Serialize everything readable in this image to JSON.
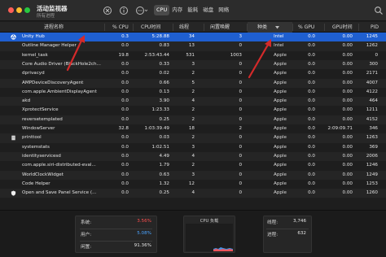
{
  "window": {
    "title": "活动监视器",
    "subtitle": "所有进程"
  },
  "toolbar": {
    "tabs": [
      "CPU",
      "内存",
      "能耗",
      "磁盘",
      "网络"
    ],
    "active_tab": "CPU",
    "icons": [
      "close-process-icon",
      "info-icon",
      "more-options-icon",
      "search-icon"
    ]
  },
  "table": {
    "columns": [
      "进程名称",
      "% CPU",
      "CPU时间",
      "线程",
      "闲置唤醒",
      "种类",
      "% GPU",
      "GPU时间",
      "PID"
    ],
    "sort_column": "种类",
    "rows": [
      {
        "name": "Unity Hub",
        "cpu": "0.3",
        "cpu_time": "5:28.88",
        "threads": "34",
        "idle_wakeups": "3",
        "kind": "Intel",
        "gpu": "0.0",
        "gpu_time": "0.00",
        "pid": "1245",
        "icon": "unity-icon",
        "selected": true
      },
      {
        "name": "Outline Manager Helper",
        "cpu": "0.0",
        "cpu_time": "0.83",
        "threads": "13",
        "idle_wakeups": "0",
        "kind": "Intel",
        "gpu": "0.0",
        "gpu_time": "0.00",
        "pid": "1262"
      },
      {
        "name": "kernel_task",
        "cpu": "19.8",
        "cpu_time": "2:53:43.44",
        "threads": "531",
        "idle_wakeups": "1003",
        "kind": "Apple",
        "gpu": "0.0",
        "gpu_time": "0.00",
        "pid": "0"
      },
      {
        "name": "Core Audio Driver (BlackHole2ch...",
        "cpu": "0.0",
        "cpu_time": "0.33",
        "threads": "3",
        "idle_wakeups": "0",
        "kind": "Apple",
        "gpu": "0.0",
        "gpu_time": "0.00",
        "pid": "300"
      },
      {
        "name": "dprivacyd",
        "cpu": "0.0",
        "cpu_time": "0.02",
        "threads": "2",
        "idle_wakeups": "0",
        "kind": "Apple",
        "gpu": "0.0",
        "gpu_time": "0.00",
        "pid": "2171"
      },
      {
        "name": "AMPDeviceDiscoveryAgent",
        "cpu": "0.0",
        "cpu_time": "0.66",
        "threads": "5",
        "idle_wakeups": "0",
        "kind": "Apple",
        "gpu": "0.0",
        "gpu_time": "0.00",
        "pid": "4007"
      },
      {
        "name": "com.apple.AmbientDisplayAgent",
        "cpu": "0.0",
        "cpu_time": "0.13",
        "threads": "2",
        "idle_wakeups": "0",
        "kind": "Apple",
        "gpu": "0.0",
        "gpu_time": "0.00",
        "pid": "4122"
      },
      {
        "name": "akd",
        "cpu": "0.0",
        "cpu_time": "3.90",
        "threads": "4",
        "idle_wakeups": "0",
        "kind": "Apple",
        "gpu": "0.0",
        "gpu_time": "0.00",
        "pid": "464"
      },
      {
        "name": "XprotectService",
        "cpu": "0.0",
        "cpu_time": "1:23.33",
        "threads": "2",
        "idle_wakeups": "0",
        "kind": "Apple",
        "gpu": "0.0",
        "gpu_time": "0.00",
        "pid": "1211"
      },
      {
        "name": "reversetemplated",
        "cpu": "0.0",
        "cpu_time": "0.25",
        "threads": "2",
        "idle_wakeups": "0",
        "kind": "Apple",
        "gpu": "0.0",
        "gpu_time": "0.00",
        "pid": "4152"
      },
      {
        "name": "WindowServer",
        "cpu": "32.8",
        "cpu_time": "1:03:39.49",
        "threads": "18",
        "idle_wakeups": "2",
        "kind": "Apple",
        "gpu": "0.0",
        "gpu_time": "2:09:09.71",
        "pid": "346"
      },
      {
        "name": "printtool",
        "cpu": "0.0",
        "cpu_time": "0.03",
        "threads": "2",
        "idle_wakeups": "0",
        "kind": "Apple",
        "gpu": "0.0",
        "gpu_time": "0.00",
        "pid": "1263",
        "icon": "document-icon"
      },
      {
        "name": "systemstats",
        "cpu": "0.0",
        "cpu_time": "1:02.51",
        "threads": "3",
        "idle_wakeups": "0",
        "kind": "Apple",
        "gpu": "0.0",
        "gpu_time": "0.00",
        "pid": "369"
      },
      {
        "name": "identityservicesd",
        "cpu": "0.0",
        "cpu_time": "4.49",
        "threads": "4",
        "idle_wakeups": "0",
        "kind": "Apple",
        "gpu": "0.0",
        "gpu_time": "0.00",
        "pid": "2006"
      },
      {
        "name": "com.apple.siri-distributed-eval...",
        "cpu": "0.0",
        "cpu_time": "1.79",
        "threads": "2",
        "idle_wakeups": "0",
        "kind": "Apple",
        "gpu": "0.0",
        "gpu_time": "0.00",
        "pid": "1246"
      },
      {
        "name": "WorldClockWidget",
        "cpu": "0.0",
        "cpu_time": "0.63",
        "threads": "3",
        "idle_wakeups": "0",
        "kind": "Apple",
        "gpu": "0.0",
        "gpu_time": "0.00",
        "pid": "1249"
      },
      {
        "name": "Code Helper",
        "cpu": "0.0",
        "cpu_time": "1.32",
        "threads": "12",
        "idle_wakeups": "0",
        "kind": "Apple",
        "gpu": "0.0",
        "gpu_time": "0.00",
        "pid": "1253"
      },
      {
        "name": "Open and Save Panel Service (...",
        "cpu": "0.0",
        "cpu_time": "0.25",
        "threads": "4",
        "idle_wakeups": "0",
        "kind": "Apple",
        "gpu": "0.0",
        "gpu_time": "0.00",
        "pid": "1260",
        "icon": "shield-icon"
      },
      {
        "name": "",
        "cpu": "",
        "cpu_time": "",
        "threads": "",
        "idle_wakeups": "",
        "kind": "",
        "gpu": "",
        "gpu_time": "",
        "pid": ""
      }
    ]
  },
  "stats": {
    "system_label": "系统:",
    "system_value": "3.56%",
    "user_label": "用户:",
    "user_value": "5.08%",
    "idle_label": "闲置:",
    "idle_value": "91.36%",
    "graph_title": "CPU 负载",
    "threads_label": "线程:",
    "threads_value": "3,746",
    "processes_label": "进程:",
    "processes_value": "632"
  },
  "colors": {
    "selected_row": "#1f5fd0",
    "system_value": "#ff4d4d",
    "user_value": "#4aa3ff",
    "annotation_arrow": "#d42a2a"
  }
}
